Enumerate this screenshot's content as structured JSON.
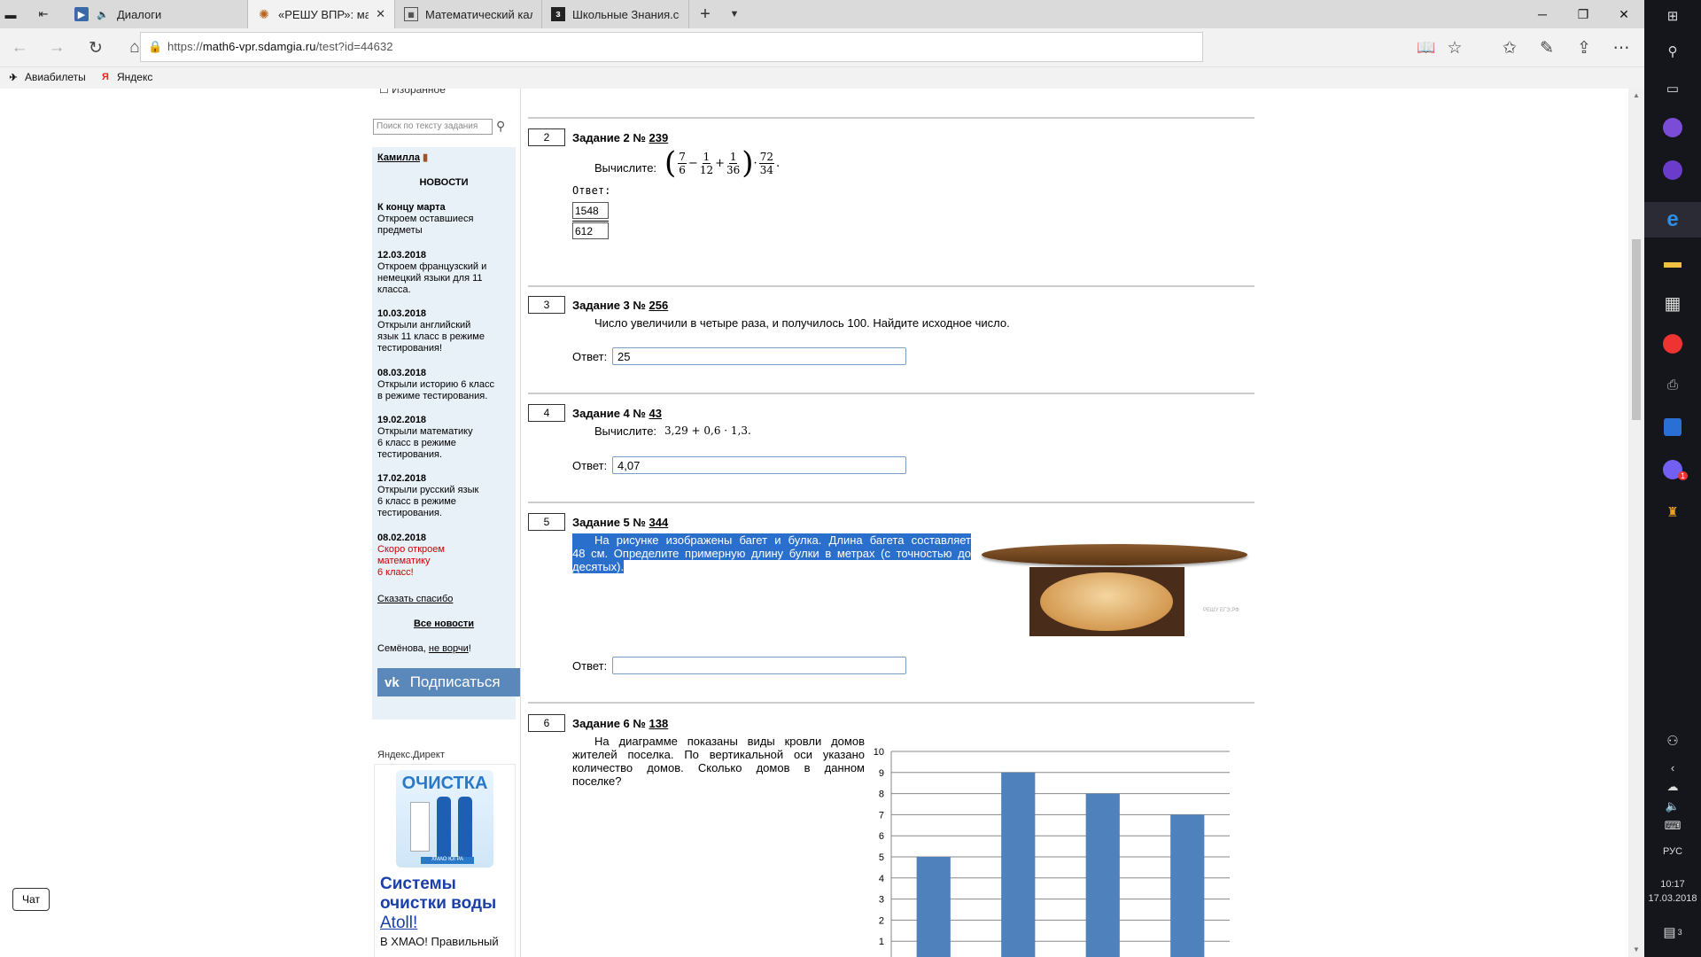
{
  "browser": {
    "tabs": [
      {
        "title": "Диалоги",
        "icon": "sound-icon",
        "color": "#3b69a8"
      },
      {
        "title": "«РЕШУ ВПР»: математ",
        "icon": "sun-icon",
        "active": true,
        "color": "#b5651d"
      },
      {
        "title": "Математический калькул",
        "icon": "calc-icon",
        "color": "#555555"
      },
      {
        "title": "Школьные Знания.com - Р",
        "icon": "znanija-icon",
        "color": "#222222"
      }
    ],
    "close_glyph": "✕",
    "new_tab_glyph": "+",
    "url_prefix": "https://",
    "url_host": "math6-vpr.sdamgia.ru",
    "url_path": "/test?id=44632",
    "bookmarks": [
      {
        "label": "Авиабилеты"
      },
      {
        "label": "Яндекс"
      }
    ]
  },
  "sidebar": {
    "favorite": "Избранное",
    "search_placeholder": "Поиск по тексту задания",
    "user": "Камилла",
    "news_title": "НОВОСТИ",
    "news": [
      {
        "date": "К концу марта",
        "text": [
          "Откроем оставшиеся",
          "предметы"
        ]
      },
      {
        "date": "12.03.2018",
        "text": [
          "Откроем французский и",
          "немецкий языки для 11",
          "класса."
        ]
      },
      {
        "date": "10.03.2018",
        "text": [
          "Открыли английский",
          "язык 11 класс в режиме",
          "тестирования!"
        ]
      },
      {
        "date": "08.03.2018",
        "text": [
          "Открыли историю 6 класс",
          "в режиме тестирования."
        ]
      },
      {
        "date": "19.02.2018",
        "text": [
          "Открыли математику",
          "6 класс в режиме",
          "тестирования."
        ]
      },
      {
        "date": "17.02.2018",
        "text": [
          "Открыли русский язык",
          "6 класс в режиме",
          "тестирования."
        ]
      },
      {
        "date": "08.02.2018",
        "text": [
          "Скоро откроем",
          "математику",
          "6 класс!"
        ],
        "red": true
      }
    ],
    "thanks": "Сказать спасибо",
    "all_news": "Все новости",
    "signature_text": "Семёнова, ",
    "signature_link": "не ворчи",
    "signature_end": "!",
    "vk_logo": "vk",
    "vk_label": "Подписаться",
    "ad_label": "Яндекс.Директ",
    "ad_pic_title": "ОЧИСТКА",
    "ad_pic_caption": "ХМАО ЮГРА",
    "ad_headline": "Системы очистки воды",
    "ad_headline_link": "Atoll!",
    "ad_text": "В ХМАО! Правильный"
  },
  "tasks": [
    {
      "num": "2",
      "title": "Задание 2 № ",
      "id": "239",
      "prompt": "Вычислите:",
      "answer_label": "Ответ:",
      "answer_num": "1548",
      "answer_den": "612",
      "expr": {
        "f1": [
          "7",
          "6"
        ],
        "f2": [
          "1",
          "12"
        ],
        "f3": [
          "1",
          "36"
        ],
        "f4": [
          "72",
          "34"
        ]
      }
    },
    {
      "num": "3",
      "title": "Задание 3 № ",
      "id": "256",
      "text": "Число увеличили в четыре раза, и получилось 100. Найдите исходное число.",
      "answer_label": "Ответ:",
      "answer": "25"
    },
    {
      "num": "4",
      "title": "Задание 4 № ",
      "id": "43",
      "prompt": "Вычислите:",
      "expr": "3,29 + 0,6 · 1,3.",
      "answer_label": "Ответ:",
      "answer": "4,07"
    },
    {
      "num": "5",
      "title": "Задание 5 № ",
      "id": "344",
      "text_lines": [
        "На рисунке изображены багет и булка. Длина багета составляет",
        "48 см. Определите примерную длину булки в метрах (с точностью до",
        "десятых)."
      ],
      "watermark": "РЕШУ ЕГЭ.РФ",
      "answer_label": "Ответ:",
      "answer": ""
    },
    {
      "num": "6",
      "title": "Задание 6 № ",
      "id": "138",
      "text_lines": [
        "На диаграмме показаны виды кровли домов",
        "жителей поселка. По вертикальной оси указано",
        "количество домов. Сколько домов в данном",
        "поселке?"
      ]
    }
  ],
  "chart_data": {
    "type": "bar",
    "categories": [
      "",
      "",
      "",
      ""
    ],
    "values": [
      5,
      9,
      8,
      7
    ],
    "ylim": [
      0,
      10
    ],
    "yticks": [
      "0",
      "1",
      "2",
      "3",
      "4",
      "5",
      "6",
      "7",
      "8",
      "9",
      "10"
    ],
    "grid": true,
    "bar_color": "#4f81bd"
  },
  "chat_label": "Чат",
  "taskbar": {
    "lang": "РУС",
    "time": "10:17",
    "date": "17.03.2018",
    "notifications": "3",
    "viber_badge": "1"
  }
}
